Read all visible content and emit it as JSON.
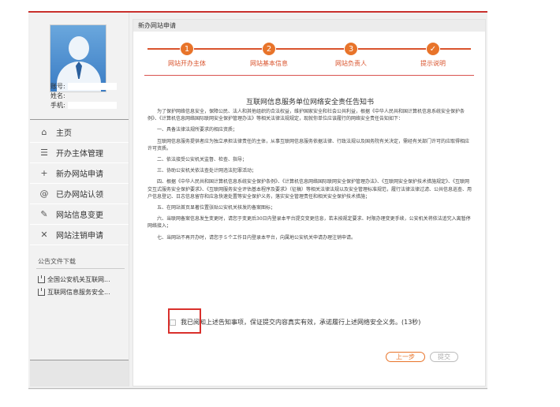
{
  "user": {
    "account_label": "账号:",
    "name_label": "姓名:",
    "phone_label": "手机:"
  },
  "menu": [
    {
      "icon": "home-icon",
      "glyph": "⌂",
      "label": "主页"
    },
    {
      "icon": "list-icon",
      "glyph": "☰",
      "label": "开办主体管理"
    },
    {
      "icon": "plus-icon",
      "glyph": "+",
      "label": "新办网站申请"
    },
    {
      "icon": "at-icon",
      "glyph": "@",
      "label": "已办网站认领"
    },
    {
      "icon": "edit-icon",
      "glyph": "✎",
      "label": "网站信息变更"
    },
    {
      "icon": "close-icon",
      "glyph": "✕",
      "label": "网站注销申请"
    }
  ],
  "notice": {
    "title": "公告文件下载",
    "files": [
      "全国公安机关互联网...",
      "互联网信息服务安全..."
    ]
  },
  "main": {
    "header": "新办网站申请",
    "steps": [
      {
        "num": "1",
        "label": "网站开办主体"
      },
      {
        "num": "2",
        "label": "网站基本信息"
      },
      {
        "num": "3",
        "label": "网站负责人"
      },
      {
        "num": "✓",
        "label": "提示说明"
      }
    ],
    "doc_title": "互联网信息服务单位网络安全责任告知书",
    "paragraphs": [
      "为了保护网络信息安全，保障公民、法人和其他组织的合法权益，维护国家安全和社会公共利益，根据《中华人民共和国计算机信息系统安全保护条例》、《计算机信息网络国际联网安全保护管理办法》等相关法律法规规定，现就你单位应该履行的网络安全责任告知如下：",
      "一、具备法律法规所要求的相应资质；",
      "互联网信息服务提供者应为独立承担法律责任的主体，从事互联网信息服务依据法律、行政法规以及国务院有关决定，需经有关部门许可的应取得相应许可资质。",
      "二、依法接受公安机关监督、检查、指导；",
      "三、协助公安机关依法查处计网违法犯罪活动；",
      "四、根据《中华人民共和国计算机信息系统安全保护条例》、《计算机信息网络国际联网安全保护管理办法》、《互联网安全保护技术措施规定》、《互联网交互式服务安全保护要求》、《互联网服务安全评估基本程序及要求》（征稿）等相关法律法规以及安全管理标准规范，履行法律法律过滤、公共信息巡查、用户信息登记、日志信息留存和应急快速处置等安全保护义务，落实安全管理责任和相关安全保护技术措施；",
      "五、在网站首页显著位置张贴公安机关核发的备案图标；",
      "六、当联网备案信息发生变更时，请您于变更后30日内登录本平台提交变更信息，若未按规定要求、时限办理变更手续，公安机关将依法追究入离暂停网络接入；",
      "七、当网站不再开办时，请您于５个工作日内登录本平台，向属地公安机关申请办理注销申请。"
    ],
    "agree_text": "我已阅知上述告知事项，保证提交内容真实有效，承诺履行上述网络安全义务。(13秒)",
    "btn_prev": "上一步",
    "btn_submit": "提交"
  }
}
